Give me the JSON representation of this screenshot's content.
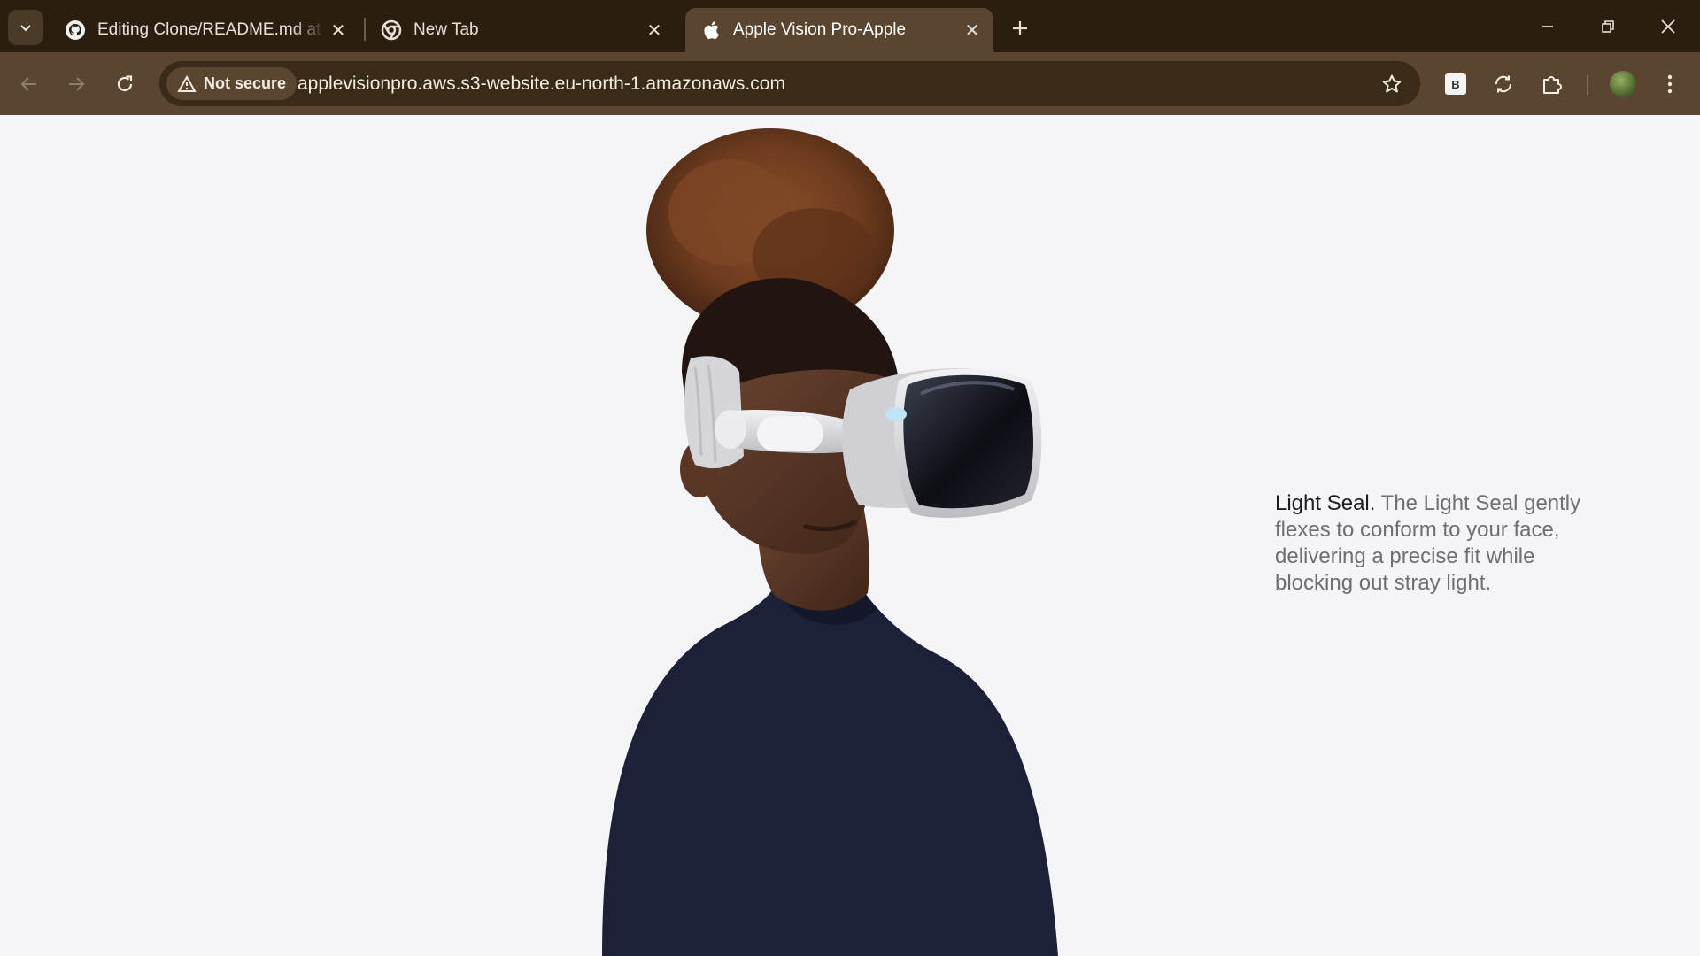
{
  "browser": {
    "tabs": [
      {
        "title": "Editing Clone/README.md at m",
        "icon": "github-icon"
      },
      {
        "title": "New Tab",
        "icon": "chrome-icon"
      },
      {
        "title": "Apple Vision Pro-Apple",
        "icon": "apple-icon",
        "active": true
      }
    ],
    "security_label": "Not secure",
    "url": "applevisionpro.aws.s3-website.eu-north-1.amazonaws.com",
    "extension_label": "B"
  },
  "page": {
    "caption_lead": "Light Seal.",
    "caption_body": " The Light Seal gently flexes to conform to your face, delivering a precise fit while blocking out stray light."
  },
  "colors": {
    "tabstrip": "#2b1d0f",
    "toolbar": "#5a4630",
    "page_background": "#f5f5f7",
    "caption_lead": "#1d1d1f",
    "caption_body": "#6e6e73"
  }
}
